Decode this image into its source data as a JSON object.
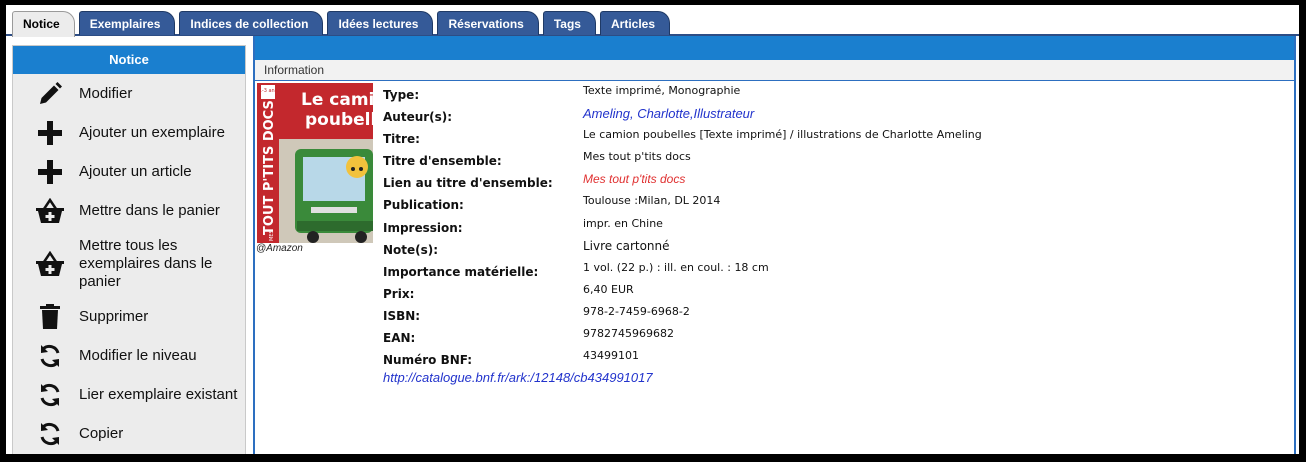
{
  "tabs": [
    {
      "label": "Notice",
      "active": true
    },
    {
      "label": "Exemplaires"
    },
    {
      "label": "Indices de collection"
    },
    {
      "label": "Idées lectures"
    },
    {
      "label": "Réservations"
    },
    {
      "label": "Tags"
    },
    {
      "label": "Articles"
    }
  ],
  "sidebar": {
    "title": "Notice",
    "items": [
      {
        "label": "Modifier",
        "icon": "pencil-icon"
      },
      {
        "label": "Ajouter un exemplaire",
        "icon": "plus-icon"
      },
      {
        "label": "Ajouter un article",
        "icon": "plus-icon"
      },
      {
        "label": "Mettre dans le panier",
        "icon": "basket-icon"
      },
      {
        "label": "Mettre tous les exemplaires dans le panier",
        "icon": "basket-icon"
      },
      {
        "label": "Supprimer",
        "icon": "trash-icon"
      },
      {
        "label": "Modifier le niveau",
        "icon": "refresh-icon"
      },
      {
        "label": "Lier exemplaire existant",
        "icon": "refresh-icon"
      },
      {
        "label": "Copier",
        "icon": "refresh-icon"
      }
    ]
  },
  "main": {
    "section_title": "Information",
    "cover": {
      "title_line1": "Le camion",
      "title_line2": "poubelle",
      "series_badge": "TOUT P'TITS DOCS",
      "series_prefix": "MES",
      "age_badge": "1-3 ans",
      "credit": "@Amazon"
    },
    "fields": [
      {
        "label": "Type:",
        "value": "Texte imprimé, Monographie"
      },
      {
        "label": "Auteur(s):",
        "value": "Ameling, Charlotte,Illustrateur",
        "style": "link"
      },
      {
        "label": "Titre:",
        "value": "Le camion poubelles [Texte imprimé] / illustrations de Charlotte Ameling"
      },
      {
        "label": "Titre d'ensemble:",
        "value": "Mes tout p'tits docs"
      },
      {
        "label": "Lien au titre d'ensemble:",
        "value": "Mes tout p'tits docs",
        "style": "redlink"
      },
      {
        "label": "Publication:",
        "value": "Toulouse :Milan, DL 2014"
      },
      {
        "label": "Impression:",
        "value": "impr. en Chine"
      },
      {
        "label": "Note(s):",
        "value": "Livre cartonné",
        "style": "big"
      },
      {
        "label": "Importance matérielle:",
        "value": "1 vol. (22 p.) : ill. en coul. : 18 cm"
      },
      {
        "label": "Prix:",
        "value": "6,40 EUR"
      },
      {
        "label": "ISBN:",
        "value": "978-2-7459-6968-2"
      },
      {
        "label": "EAN:",
        "value": "9782745969682"
      },
      {
        "label": "Numéro BNF:",
        "value": "43499101"
      }
    ],
    "bnf_link": "http://catalogue.bnf.fr/ark:/12148/cb434991017"
  },
  "colors": {
    "tab_blue": "#355a98",
    "header_blue": "#1a7fcf",
    "link_blue": "#2233cc",
    "link_red": "#e03030",
    "sidebar_bg": "#ececec"
  }
}
